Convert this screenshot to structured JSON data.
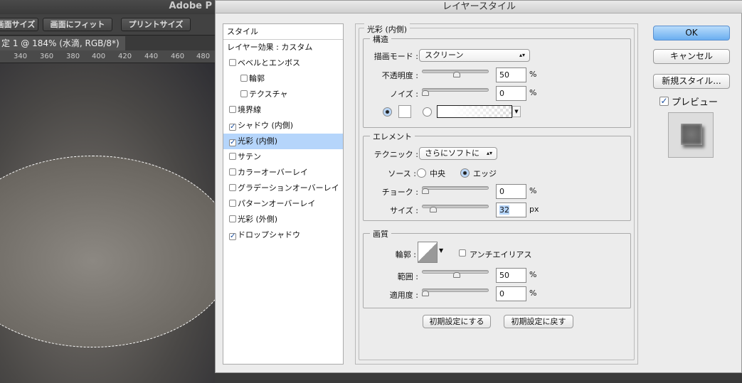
{
  "photoshop": {
    "app_title": "Adobe P",
    "options_buttons": [
      "画面サイズ",
      "画面にフィット",
      "プリントサイズ"
    ],
    "document_tab": "定 1 @ 184% (水滴, RGB/8*) *",
    "ruler_ticks": [
      "340",
      "360",
      "380",
      "400",
      "420",
      "440",
      "460",
      "480"
    ]
  },
  "dialog": {
    "title": "レイヤースタイル",
    "styles_list": [
      {
        "label": "スタイル",
        "type": "header"
      },
      {
        "label": "レイヤー効果 : カスタム",
        "type": "header"
      },
      {
        "label": "ベベルとエンボス",
        "checked": false
      },
      {
        "label": "輪郭",
        "checked": false,
        "indent": true
      },
      {
        "label": "テクスチャ",
        "checked": false,
        "indent": true
      },
      {
        "label": "境界線",
        "checked": false
      },
      {
        "label": "シャドウ (内側)",
        "checked": true
      },
      {
        "label": "光彩 (内側)",
        "checked": true,
        "selected": true
      },
      {
        "label": "サテン",
        "checked": false
      },
      {
        "label": "カラーオーバーレイ",
        "checked": false
      },
      {
        "label": "グラデーションオーバーレイ",
        "checked": false
      },
      {
        "label": "パターンオーバーレイ",
        "checked": false
      },
      {
        "label": "光彩 (外側)",
        "checked": false
      },
      {
        "label": "ドロップシャドウ",
        "checked": true
      }
    ],
    "section_title": "光彩 (内側)",
    "structure": {
      "legend": "構造",
      "blend_mode_label": "描画モード :",
      "blend_mode": "スクリーン",
      "opacity_label": "不透明度 :",
      "opacity": "50",
      "opacity_unit": "%",
      "noise_label": "ノイズ :",
      "noise": "0",
      "noise_unit": "%",
      "color_mode": "solid",
      "color": "#ffffff"
    },
    "elements": {
      "legend": "エレメント",
      "technique_label": "テクニック :",
      "technique": "さらにソフトに",
      "source_label": "ソース :",
      "source_options": [
        "中央",
        "エッジ"
      ],
      "source_selected": "エッジ",
      "choke_label": "チョーク :",
      "choke": "0",
      "choke_unit": "%",
      "size_label": "サイズ :",
      "size": "32",
      "size_unit": "px",
      "size_max": 250
    },
    "quality": {
      "legend": "画質",
      "contour_label": "輪郭 :",
      "antialias_label": "アンチエイリアス",
      "antialias": false,
      "range_label": "範囲 :",
      "range": "50",
      "range_unit": "%",
      "jitter_label": "適用度 :",
      "jitter": "0",
      "jitter_unit": "%"
    },
    "make_default": "初期設定にする",
    "reset_default": "初期設定に戻す",
    "ok": "OK",
    "cancel": "キャンセル",
    "new_style": "新規スタイル...",
    "preview_label": "プレビュー",
    "preview": true
  }
}
